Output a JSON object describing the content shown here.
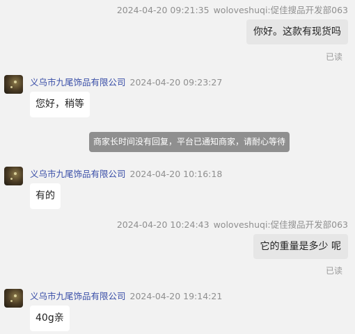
{
  "messages": {
    "m1": {
      "time": "2024-04-20 09:21:35",
      "sender": "woloveshuqi:促佳搜品开发部063",
      "text": "你好。这款有现货吗",
      "status": "已读"
    },
    "m2": {
      "shop": "义乌市九尾饰品有限公司",
      "time": "2024-04-20 09:23:27",
      "text": "您好，稍等"
    },
    "system": {
      "text": "商家长时间没有回复，平台已通知商家，请耐心等待"
    },
    "m3": {
      "shop": "义乌市九尾饰品有限公司",
      "time": "2024-04-20 10:16:18",
      "text": "有的"
    },
    "m4": {
      "time": "2024-04-20 10:24:43",
      "sender": "woloveshuqi:促佳搜品开发部063",
      "text": "它的重量是多少 呢",
      "status": "已读"
    },
    "m5": {
      "shop": "义乌市九尾饰品有限公司",
      "time": "2024-04-20 19:14:21",
      "text": "40g亲"
    }
  },
  "colors": {
    "background": "#f2f2f2",
    "shop_name": "#3a4fa8",
    "outgoing_bubble": "#e6e6e6",
    "incoming_bubble": "#ffffff",
    "system_notice": "#8f8f8f"
  }
}
